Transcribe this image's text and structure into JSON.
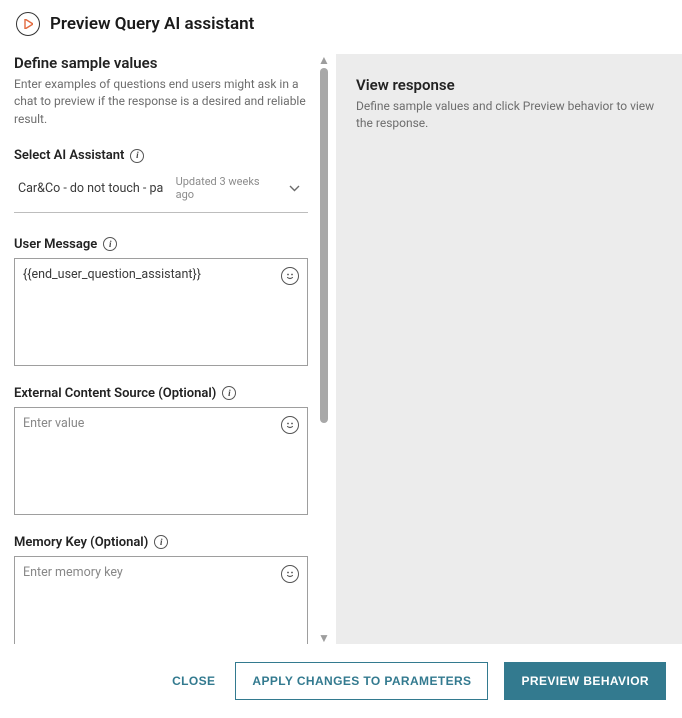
{
  "header": {
    "title": "Preview Query AI assistant"
  },
  "left": {
    "define": {
      "title": "Define sample values",
      "desc": "Enter examples of questions end users might ask in a chat to preview if the response is a desired and reliable result."
    },
    "assistant_select": {
      "label": "Select AI Assistant",
      "value": "Car&Co  - do not touch - pa",
      "meta": "Updated 3 weeks ago"
    },
    "user_message": {
      "label": "User Message",
      "value": "{{end_user_question_assistant}}"
    },
    "external_content": {
      "label": "External Content Source (Optional)",
      "placeholder": "Enter value"
    },
    "memory_key": {
      "label": "Memory Key (Optional)",
      "placeholder": "Enter memory key"
    }
  },
  "right": {
    "title": "View response",
    "desc": "Define sample values and click Preview behavior to view the response."
  },
  "footer": {
    "close": "CLOSE",
    "apply": "APPLY CHANGES TO PARAMETERS",
    "preview": "PREVIEW BEHAVIOR"
  }
}
